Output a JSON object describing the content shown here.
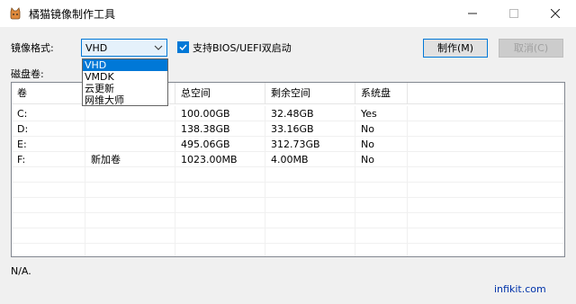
{
  "window": {
    "title": "橘猫镜像制作工具",
    "icon": "cat-app-icon",
    "controls": [
      "minimize-icon",
      "maximize-icon",
      "close-icon"
    ]
  },
  "form": {
    "format_label": "镜像格式:",
    "format_selected": "VHD",
    "format_options": [
      "VHD",
      "VMDK",
      "云更新",
      "网维大师"
    ],
    "bios_checkbox_label": "支持BIOS/UEFI双启动",
    "bios_checked": true,
    "make_button": "制作(M)",
    "cancel_button": "取消(C)",
    "volumes_label": "磁盘卷:"
  },
  "table": {
    "headers": [
      "卷",
      "",
      "总空间",
      "剩余空间",
      "系统盘"
    ],
    "rows": [
      [
        "C:",
        "",
        "100.00GB",
        "32.48GB",
        "Yes"
      ],
      [
        "D:",
        "",
        "138.38GB",
        "33.16GB",
        "No"
      ],
      [
        "E:",
        "",
        "495.06GB",
        "312.73GB",
        "No"
      ],
      [
        "F:",
        "新加卷",
        "1023.00MB",
        "4.00MB",
        "No"
      ]
    ]
  },
  "status_text": "N/A.",
  "footer_link": "infikit.com",
  "colors": {
    "accent": "#0078d7",
    "link": "#0033aa"
  }
}
